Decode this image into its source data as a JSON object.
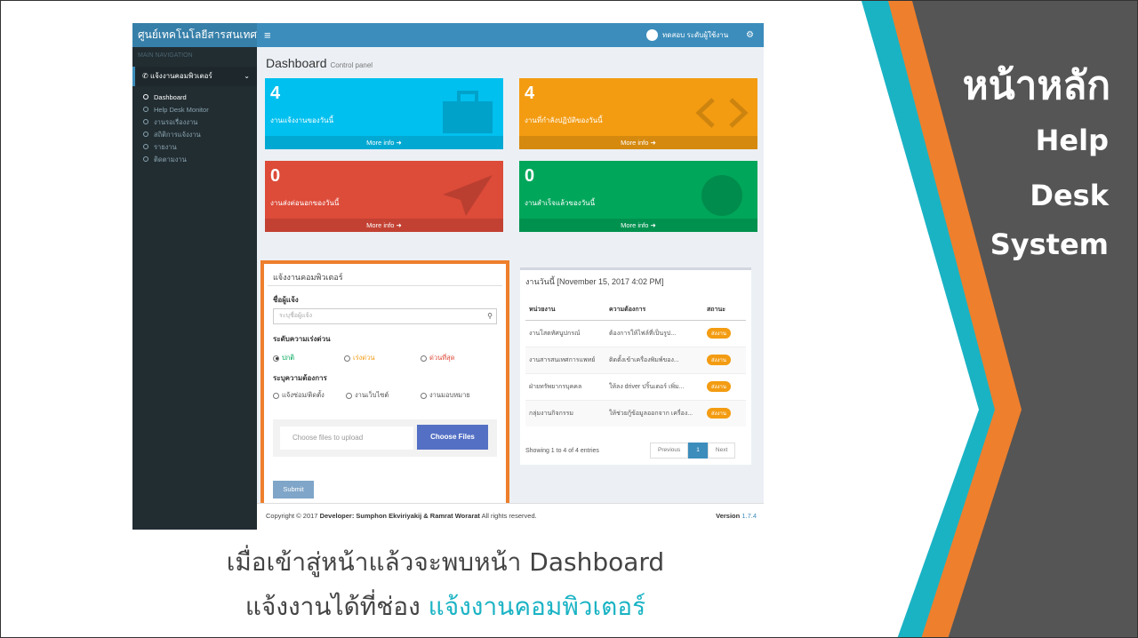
{
  "slide": {
    "title": "หน้าหลัก",
    "subtitle_lines": [
      "Help",
      "Desk",
      "System"
    ],
    "caption_line1": "เมื่อเข้าสู่หน้าแล้วจะพบหน้า Dashboard",
    "caption_line2_prefix": "แจ้งงานได้ที่ช่อง ",
    "caption_line2_highlight": "แจ้งงานคอมพิวเตอร์",
    "colors": {
      "teal": "#1ab3c4",
      "orange": "#ee7f2d",
      "gray": "#555555"
    }
  },
  "app": {
    "logo": "ศูนย์เทคโนโลยีสารสนเทศ",
    "menu_icon": "hamburger-icon",
    "user_name": "ทดสอบ ระดับผู้ใช้งาน",
    "gears_icon": "gears-icon"
  },
  "sidebar": {
    "header": "MAIN NAVIGATION",
    "parent": "แจ้งงานคอมพิวเตอร์",
    "items": [
      {
        "label": "Dashboard",
        "active": true
      },
      {
        "label": "Help Desk Monitor",
        "active": false
      },
      {
        "label": "งานรอเรื่องงาน",
        "active": false
      },
      {
        "label": "สถิติการแจ้งงาน",
        "active": false
      },
      {
        "label": "รายงาน",
        "active": false
      },
      {
        "label": "ติดตามงาน",
        "active": false
      }
    ]
  },
  "page": {
    "title": "Dashboard",
    "subtitle": "Control panel"
  },
  "boxes": [
    {
      "num": "4",
      "label": "งานแจ้งงานของวันนี้",
      "more": "More info",
      "color": "#00c0ef",
      "icon": "briefcase-icon"
    },
    {
      "num": "4",
      "label": "งานที่กำลังปฏิบัติของวันนี้",
      "more": "More info",
      "color": "#f39c12",
      "icon": "code-icon"
    },
    {
      "num": "0",
      "label": "งานส่งต่อนอกของวันนี้",
      "more": "More info",
      "color": "#dd4b39",
      "icon": "paper-plane-icon"
    },
    {
      "num": "0",
      "label": "งานสำเร็จแล้วของวันนี้",
      "more": "More info",
      "color": "#00a65a",
      "icon": "check-circle-icon"
    }
  ],
  "form": {
    "heading": "แจ้งงานคอมพิวเตอร์",
    "name_label": "ชื่อผู้แจ้ง",
    "name_placeholder": "ระบุชื่อผู้แจ้ง",
    "urgency_label": "ระดับความเร่งด่วน",
    "urgency_options": [
      "ปกติ",
      "เร่งด่วน",
      "ด่วนที่สุด"
    ],
    "need_label": "ระบุความต้องการ",
    "need_options": [
      "แจ้งซ่อม/ติดตั้ง",
      "งานเว็บไซต์",
      "งานมอบหมาย"
    ],
    "file_placeholder": "Choose files to upload",
    "file_button": "Choose Files",
    "submit": "Submit"
  },
  "table": {
    "heading": "งานวันนี้ [November 15, 2017 4:02 PM]",
    "columns": [
      "หน่วยงาน",
      "ความต้องการ",
      "สถานะ"
    ],
    "rows": [
      {
        "dept": "งานโสตทัศนูปกรณ์",
        "need": "ต้องการให้ไฟล์ที่เป็นรูป...",
        "status": "ส่งงาน"
      },
      {
        "dept": "งานสารสนเทศการแพทย์",
        "need": "ติดตั้งเข้าเครื่องพิมพ์ของ...",
        "status": "ส่งงาน"
      },
      {
        "dept": "ฝ่ายทรัพยากรบุคคล",
        "need": "ให้ลง driver ปริ้นเตอร์ เพิ่ม...",
        "status": "ส่งงาน"
      },
      {
        "dept": "กลุ่มงานกิจกรรม",
        "need": "ให้ช่วยกู้ข้อมูลออกจาก เครื่อง...",
        "status": "ส่งงาน"
      }
    ],
    "entries": "Showing 1 to 4 of 4 entries",
    "prev": "Previous",
    "page": "1",
    "next": "Next"
  },
  "footer": {
    "copyright": "Copyright © 2017",
    "developer": "Developer: Sumphon Ekviriyakij & Ramrat Worarat",
    "rights": "All rights reserved.",
    "version_label": "Version",
    "version": "1.7.4"
  }
}
